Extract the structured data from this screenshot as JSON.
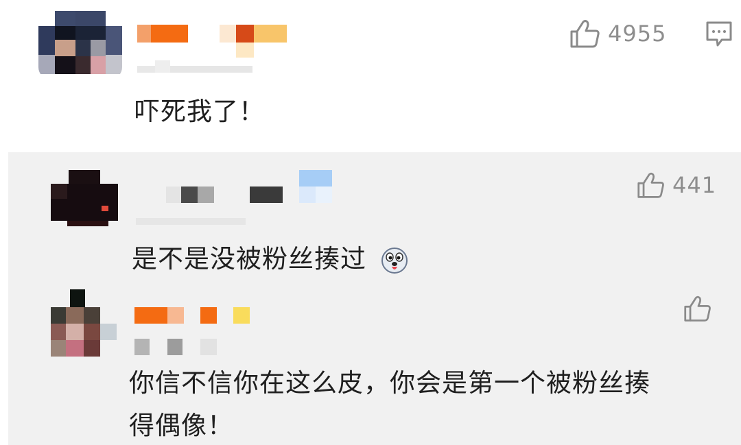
{
  "top_comment": {
    "text": "吓死我了！",
    "like_count": "4955"
  },
  "replies": [
    {
      "text": "是不是没被粉丝揍过",
      "like_count": "441",
      "emoji": "dog-face-emoji"
    },
    {
      "text_line1": "你信不信你在这么皮，你会是第一个被粉丝揍",
      "text_line2": "得偶像！",
      "like_count": ""
    }
  ],
  "colors": {
    "reply_background": "#f1f1f1",
    "orange_pixel": "#f46b12",
    "icon_gray": "#8a8a8a"
  }
}
